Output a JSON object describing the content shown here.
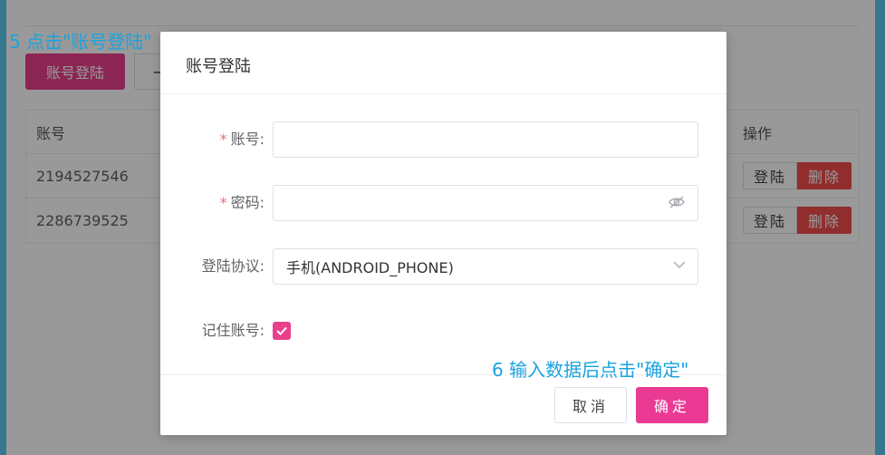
{
  "toolbar": {
    "account_login_label": "账号登陆",
    "second_button_label": "一"
  },
  "table": {
    "headers": {
      "account": "账号",
      "operation": "操作"
    },
    "rows": [
      {
        "account": "2194527546",
        "login": "登陆",
        "delete": "删除"
      },
      {
        "account": "2286739525",
        "login": "登陆",
        "delete": "删除"
      }
    ]
  },
  "annotations": {
    "step5": "5 点击\"账号登陆\"",
    "step6": "6 输入数据后点击\"确定\""
  },
  "dialog": {
    "title": "账号登陆",
    "fields": {
      "account": {
        "label": "账号:",
        "required": "*",
        "value": "",
        "placeholder": ""
      },
      "password": {
        "label": "密码:",
        "required": "*",
        "value": "",
        "placeholder": "",
        "icon": "eye-slash-icon"
      },
      "protocol": {
        "label": "登陆协议:",
        "value": "手机(ANDROID_PHONE)",
        "icon": "chevron-down-icon"
      },
      "remember": {
        "label": "记住账号:",
        "checked": true
      }
    },
    "buttons": {
      "cancel": "取消",
      "confirm": "确定"
    }
  },
  "colors": {
    "accent": "#e8408c",
    "danger": "#f24c4c",
    "annotation": "#1aa3e0",
    "frame": "#5bc8ec"
  }
}
